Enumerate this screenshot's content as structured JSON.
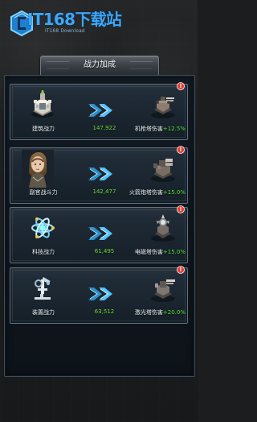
{
  "brand": {
    "title": "IT168下载站",
    "subtitle": "IT168 Download"
  },
  "screen": {
    "title": "战力加成"
  },
  "cards": [
    {
      "left_label": "建筑战力",
      "value": "147,922",
      "right_label_prefix": "机枪塔伤害",
      "right_label_pct": "+12.5%",
      "left_icon": "building-icon",
      "right_icon": "machine-gun-tower-icon",
      "notice": "!"
    },
    {
      "left_label": "副官战斗力",
      "value": "142,477",
      "right_label_prefix": "火箭炮塔伤害",
      "right_label_pct": "+15.0%",
      "left_icon": "officer-portrait-icon",
      "right_icon": "rocket-tower-icon",
      "notice": "!"
    },
    {
      "left_label": "科技战力",
      "value": "61,495",
      "right_label_prefix": "电磁塔伤害",
      "right_label_pct": "+15.0%",
      "left_icon": "atom-icon",
      "right_icon": "electromagnetic-tower-icon",
      "notice": "!"
    },
    {
      "left_label": "装置战力",
      "value": "63,512",
      "right_label_prefix": "激光塔伤害",
      "right_label_pct": "+20.0%",
      "left_icon": "microscope-icon",
      "right_icon": "laser-tower-icon",
      "notice": "!"
    }
  ],
  "colors": {
    "accent_blue": "#3aa8ff",
    "green": "#71df37",
    "panel_border": "#627281",
    "notice_red": "#e53c2f"
  }
}
